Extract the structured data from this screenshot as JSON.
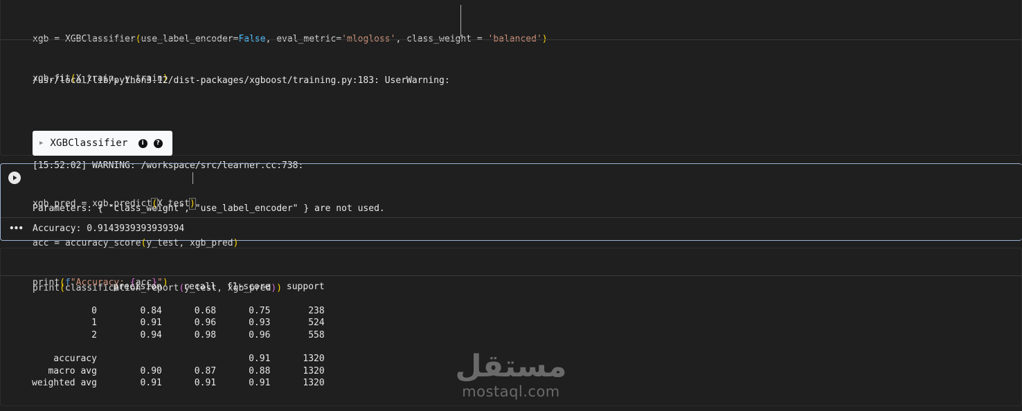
{
  "cell1": {
    "code": {
      "line1_a": "xgb = XGBClassifier",
      "line1_b": "use_label_encoder=",
      "line1_false": "False",
      "line1_c": ", eval_metric=",
      "line1_str1": "'mlogloss'",
      "line1_d": ", class_weight = ",
      "line1_str2": "'balanced'",
      "line2_a": "xgb.fit",
      "line2_b": "X_train, y_train"
    },
    "output": {
      "warning_path": "/usr/local/lib/python3.12/dist-packages/xgboost/training.py:183: UserWarning:",
      "warning_line1": "[15:52:02] WARNING: /workspace/src/learner.cc:738:",
      "warning_line2": "Parameters: { \"class_weight\", \"use_label_encoder\" } are not used."
    },
    "estimator_badge": {
      "name": "XGBClassifier",
      "toggle_icon": "triangle-right-icon",
      "info_icon": "info-icon",
      "help_icon": "help-icon"
    }
  },
  "cell2": {
    "run_icon": "play-icon",
    "code": {
      "line1_a": "xgb_pred = xgb.predict",
      "line1_b": "X_test",
      "line2_a": "acc = accuracy_score",
      "line2_b": "y_test, xgb_pred",
      "line3_a": "print",
      "line3_f": "f",
      "line3_str1": "\"Accuracy: ",
      "line3_var": "acc",
      "line3_str2": "\""
    },
    "output_menu_icon": "more-horizontal-icon",
    "output": "Accuracy: 0.9143939393939394"
  },
  "cell3": {
    "code": {
      "line1_a": "print",
      "line1_b": "classification_report",
      "line1_c": "y_test, xgb_pred"
    },
    "report": {
      "headers": [
        "precision",
        "recall",
        "f1-score",
        "support"
      ],
      "rows": [
        {
          "label": "0",
          "precision": "0.84",
          "recall": "0.68",
          "f1": "0.75",
          "support": "238"
        },
        {
          "label": "1",
          "precision": "0.91",
          "recall": "0.96",
          "f1": "0.93",
          "support": "524"
        },
        {
          "label": "2",
          "precision": "0.94",
          "recall": "0.98",
          "f1": "0.96",
          "support": "558"
        }
      ],
      "summary": [
        {
          "label": "accuracy",
          "precision": "",
          "recall": "",
          "f1": "0.91",
          "support": "1320"
        },
        {
          "label": "macro avg",
          "precision": "0.90",
          "recall": "0.87",
          "f1": "0.88",
          "support": "1320"
        },
        {
          "label": "weighted avg",
          "precision": "0.91",
          "recall": "0.91",
          "f1": "0.91",
          "support": "1320"
        }
      ]
    }
  },
  "watermark": {
    "arabic": "مستقل",
    "latin": "mostaql.com"
  },
  "colors": {
    "background": "#1f1f1f",
    "keyword_false": "#4fc1ff",
    "string": "#ce9178",
    "active_cell_border": "#9cb3d6"
  }
}
